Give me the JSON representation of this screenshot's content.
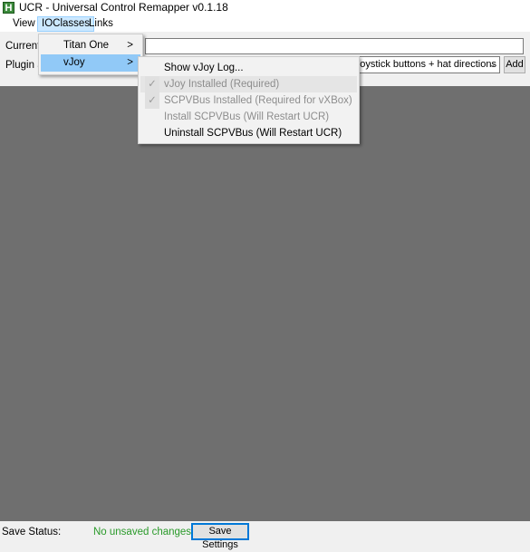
{
  "window": {
    "title": "UCR - Universal Control Remapper v0.1.18",
    "icon_letter": "H",
    "icon": "app-icon"
  },
  "menubar": [
    {
      "label": "View"
    },
    {
      "label": "IOClasses"
    },
    {
      "label": "Links"
    }
  ],
  "ioclasses_menu": [
    {
      "label": "Titan One",
      "submenu_arrow": ">"
    },
    {
      "label": "vJoy",
      "submenu_arrow": ">"
    }
  ],
  "vjoy_menu": [
    {
      "label": "Show vJoy Log...",
      "enabled": true,
      "checked": false
    },
    {
      "label": "vJoy Installed (Required)",
      "enabled": false,
      "checked": true
    },
    {
      "label": "SCPVBus Installed (Required for vXBox)",
      "enabled": false,
      "checked": true
    },
    {
      "label": "Install SCPVBus (Will Restart UCR)",
      "enabled": false,
      "checked": false
    },
    {
      "label": "Uninstall SCPVBus (Will Restart UCR)",
      "enabled": true,
      "checked": false
    }
  ],
  "toolbar": {
    "current_profile_label": "Current P",
    "plugin_label": "Plugin Se",
    "plugin_select_value": "ns, Joystick buttons + hat directions",
    "add_label": "Add"
  },
  "status": {
    "label": "Save Status:",
    "value": "No unsaved changes",
    "value_color": "#2a9a2a",
    "save_button": "Save Settings"
  },
  "colors": {
    "accent": "#0078d7",
    "highlight": "#91c9f7",
    "main_bg": "#6f6f6f"
  }
}
